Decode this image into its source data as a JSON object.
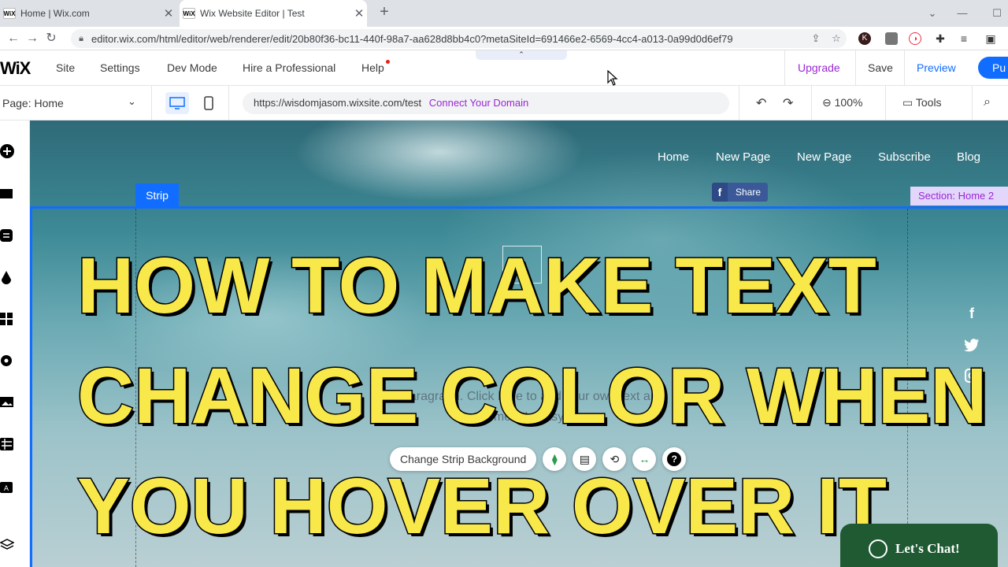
{
  "browser": {
    "tabs": [
      {
        "favicon": "WiX",
        "title": "Home | Wix.com",
        "active": false
      },
      {
        "favicon": "WiX",
        "title": "Wix Website Editor | Test",
        "active": true
      }
    ],
    "url": "editor.wix.com/html/editor/web/renderer/edit/20b80f36-bc11-440f-98a7-aa628d8bb4c0?metaSiteId=691466e2-6569-4cc4-a013-0a99d0d6ef79",
    "profile_initial": "K"
  },
  "wix_topbar": {
    "logo": "WiX",
    "menu": [
      "Site",
      "Settings",
      "Dev Mode",
      "Hire a Professional",
      "Help"
    ],
    "upgrade": "Upgrade",
    "save": "Save",
    "preview": "Preview",
    "publish": "Pu"
  },
  "toolbar2": {
    "page_select": "Page: Home",
    "site_url": "https://wisdomjasom.wixsite.com/test",
    "connect_domain": "Connect Your Domain",
    "zoom": "100%",
    "tools": "Tools"
  },
  "canvas": {
    "site_nav": [
      "Home",
      "New Page",
      "New Page",
      "Subscribe",
      "Blog"
    ],
    "strip_tag": "Strip",
    "share_label": "Share",
    "section_tag": "Section: Home 2",
    "paragraph": "I'm a paragraph. Click here to add your own text and edit me. It's easy.",
    "headline_lines": [
      "HOW TO MAKE TEXT",
      "CHANGE COLOR WHEN",
      "YOU HOVER OVER IT"
    ],
    "change_bg_label": "Change Strip Background",
    "chat_label": "Let's Chat!"
  },
  "colors": {
    "wix_blue": "#116dff",
    "upgrade_purple": "#9a27d5",
    "headline_yellow": "#f8e84a",
    "chat_green": "#1f5a33"
  }
}
